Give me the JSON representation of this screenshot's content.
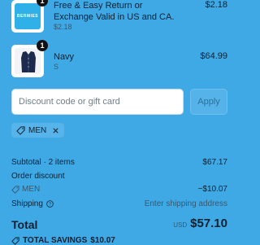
{
  "line_items": [
    {
      "quantity": "1",
      "title": "Free & Easy Return or Exchange Valid in US and CA.",
      "subtitle": "$2.18",
      "price": "$2.18",
      "thumbnail_text": "BERMIES",
      "thumbnail_color": "#2fb0e8"
    },
    {
      "quantity": "1",
      "title": "Navy",
      "subtitle": "S",
      "price": "$64.99",
      "thumbnail_color": "#1c2b4d"
    }
  ],
  "discount": {
    "placeholder": "Discount code or gift card",
    "apply_label": "Apply",
    "applied_code": "MEN"
  },
  "summary": {
    "subtotal_label": "Subtotal · 2 items",
    "subtotal_value": "$67.17",
    "order_discount_label": "Order discount",
    "discount_code": "MEN",
    "discount_value": "−$10.07",
    "shipping_label": "Shipping",
    "shipping_value": "Enter shipping address",
    "total_label": "Total",
    "currency": "USD",
    "total_value": "$57.10",
    "savings_label": "TOTAL SAVINGS",
    "savings_value": "$10.07"
  },
  "colors": {
    "background": "#3fa9e6",
    "text": "#0b2030",
    "muted": "#39586e"
  }
}
